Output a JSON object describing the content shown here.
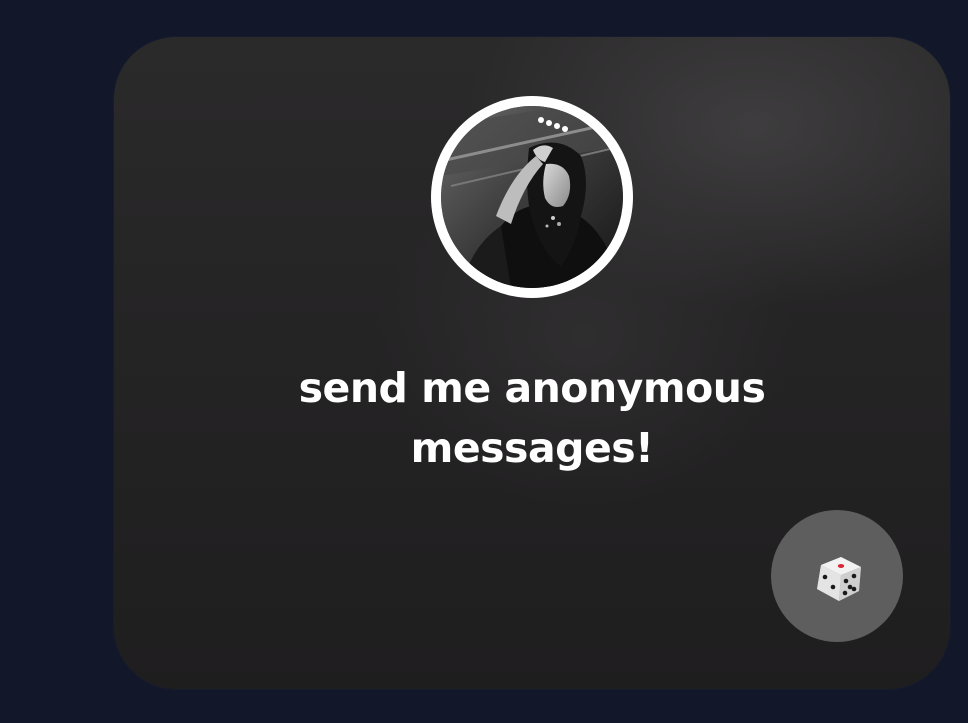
{
  "card": {
    "prompt": "send me anonymous messages!"
  },
  "profile": {
    "avatar_description": "black-and-white profile photo of a person with long dark hair, hand raised to head"
  },
  "dice": {
    "icon": "dice-icon"
  },
  "colors": {
    "page_background": "#121729",
    "card_background": "#252425",
    "avatar_ring": "#ffffff",
    "prompt_text": "#ffffff",
    "dice_button": "#5f5e5f",
    "dice_pip_accent": "#d8283a"
  }
}
